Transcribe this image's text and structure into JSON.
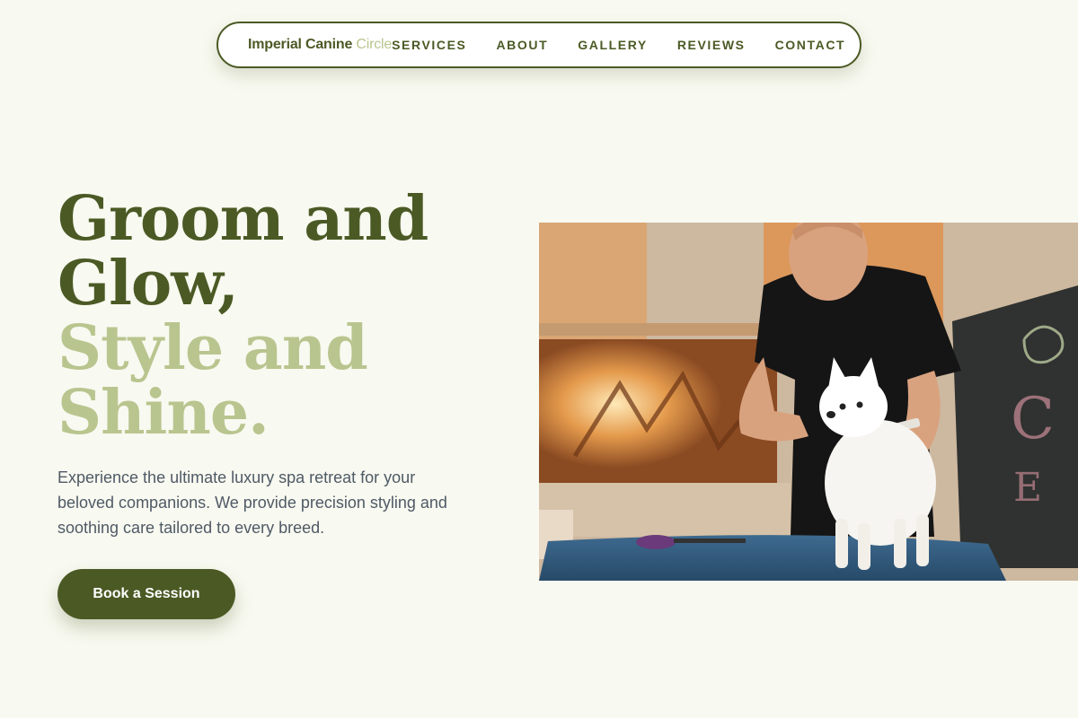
{
  "nav": {
    "brand_primary": "Imperial Canine ",
    "brand_accent": "Circle",
    "links": [
      "SERVICES",
      "ABOUT",
      "GALLERY",
      "REVIEWS",
      "CONTACT"
    ]
  },
  "hero": {
    "headline_line1": "Groom and",
    "headline_line2": "Glow,",
    "headline_line3": "Style and",
    "headline_line4": "Shine.",
    "description": "Experience the ultimate luxury spa retreat for your beloved companions. We provide precision styling and soothing care tailored to every breed.",
    "cta_label": "Book a Session",
    "image_alt": "Groomer combing a small white Pomeranian on a grooming table"
  },
  "colors": {
    "brand_dark": "#4b5a25",
    "brand_light": "#b9c58f",
    "page_bg": "#f8f9f0",
    "body_text": "#4f5a66"
  }
}
